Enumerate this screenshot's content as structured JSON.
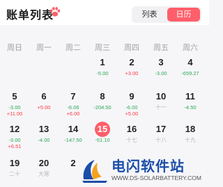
{
  "header": {
    "title": "账单列表",
    "paw_icon": "paw-icon"
  },
  "view_toggle": {
    "list_label": "列表",
    "calendar_label": "日历",
    "active": "calendar"
  },
  "colors": {
    "accent": "#ff5e6a",
    "expense": "#2aa85a",
    "income": "#ff3b46"
  },
  "weekdays": [
    "周日",
    "周一",
    "周二",
    "周三",
    "周四",
    "周五",
    "周六"
  ],
  "days": [
    {
      "day": "1",
      "lines": [
        {
          "text": "-5.00",
          "kind": "out"
        }
      ]
    },
    {
      "day": "2",
      "lines": [
        {
          "text": "+3.00",
          "kind": "in"
        }
      ]
    },
    {
      "day": "3",
      "lines": [
        {
          "text": "-3.00",
          "kind": "out"
        }
      ]
    },
    {
      "day": "4",
      "lines": [
        {
          "text": "-659.27",
          "kind": "out"
        }
      ]
    },
    {
      "day": "5",
      "lines": [
        {
          "text": "-3.00",
          "kind": "out"
        },
        {
          "text": "+11.00",
          "kind": "in"
        }
      ]
    },
    {
      "day": "6",
      "lines": [
        {
          "text": "+5.00",
          "kind": "in"
        }
      ]
    },
    {
      "day": "7",
      "lines": [
        {
          "text": "-6.06",
          "kind": "out"
        },
        {
          "text": "+6.00",
          "kind": "in"
        }
      ]
    },
    {
      "day": "8",
      "lines": [
        {
          "text": "-204.50",
          "kind": "out"
        }
      ]
    },
    {
      "day": "9",
      "lines": [
        {
          "text": "-6.00",
          "kind": "out"
        },
        {
          "text": "+5.00",
          "kind": "in"
        }
      ]
    },
    {
      "day": "10",
      "lines": [
        {
          "text": "十一",
          "kind": "lunar"
        }
      ]
    },
    {
      "day": "11",
      "lines": [
        {
          "text": "-4.50",
          "kind": "out"
        }
      ]
    },
    {
      "day": "12",
      "lines": [
        {
          "text": "-3.00",
          "kind": "out"
        },
        {
          "text": "+6.51",
          "kind": "in"
        }
      ]
    },
    {
      "day": "13",
      "lines": [
        {
          "text": "-4.00",
          "kind": "out"
        }
      ]
    },
    {
      "day": "14",
      "lines": [
        {
          "text": "-147.50",
          "kind": "out"
        }
      ]
    },
    {
      "day": "15",
      "lines": [
        {
          "text": "-51.10",
          "kind": "out"
        }
      ],
      "today": true
    },
    {
      "day": "16",
      "lines": [
        {
          "text": "十七",
          "kind": "lunar"
        }
      ]
    },
    {
      "day": "17",
      "lines": [
        {
          "text": "十八",
          "kind": "lunar"
        }
      ]
    },
    {
      "day": "18",
      "lines": [
        {
          "text": "十九",
          "kind": "lunar"
        }
      ]
    },
    {
      "day": "19",
      "lines": [
        {
          "text": "二十",
          "kind": "lunar"
        }
      ]
    },
    {
      "day": "20",
      "lines": [
        {
          "text": "大寒",
          "kind": "lunar"
        }
      ]
    },
    {
      "day": "2",
      "lines": []
    }
  ],
  "watermark": {
    "title": "电闪软件站",
    "url": "WWW.DS-SOLARBATTERY.COM"
  }
}
